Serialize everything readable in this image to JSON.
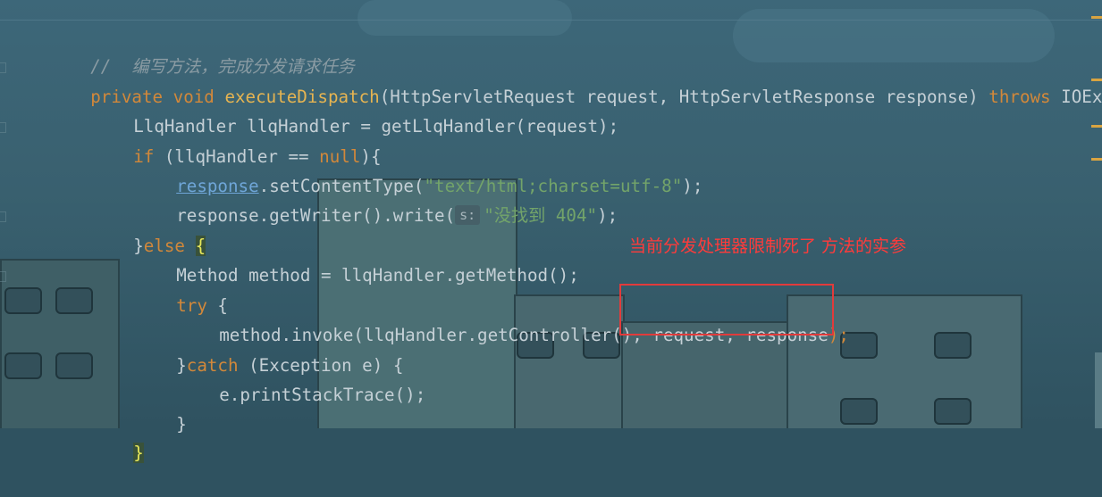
{
  "code": {
    "comment": "//  编写方法，完成分发请求任务",
    "sig": {
      "kw_private": "private",
      "kw_void": "void",
      "method_name": "executeDispatch",
      "params": "(HttpServletRequest request, HttpServletResponse response)",
      "kw_throws": "throws",
      "exception": "IOExc"
    },
    "l3": "LlqHandler llqHandler = getLlqHandler(request);",
    "l4": {
      "kw_if": "if",
      "cond": " (llqHandler == ",
      "kw_null": "null",
      "end": "){"
    },
    "l5": {
      "obj": "response",
      "call": ".setContentType(",
      "str": "\"text/html;charset=utf-8\"",
      "end": ");"
    },
    "l6": {
      "call": "response.getWriter().write(",
      "hint": "s:",
      "str": "\"没找到 404\"",
      "end": ");"
    },
    "l7": {
      "close": "}",
      "kw_else": "else",
      "brace": "{"
    },
    "l8": "Method method = llqHandler.getMethod();",
    "l9": {
      "kw_try": "try",
      "brace": " {"
    },
    "l10": {
      "call": "method.invoke(llqHandler.getController(), ",
      "args": "request, response",
      "end": ");"
    },
    "l11": {
      "close": "}",
      "kw_catch": "catch",
      "rest": " (Exception e) {"
    },
    "l12": "e.printStackTrace();",
    "l13": "}",
    "l14": "}"
  },
  "annotation": "当前分发处理器限制死了 方法的实参",
  "colors": {
    "keyword": "#d2883a",
    "method": "#e6b451",
    "string": "#73a46a",
    "annotation": "#ff3b3b"
  }
}
